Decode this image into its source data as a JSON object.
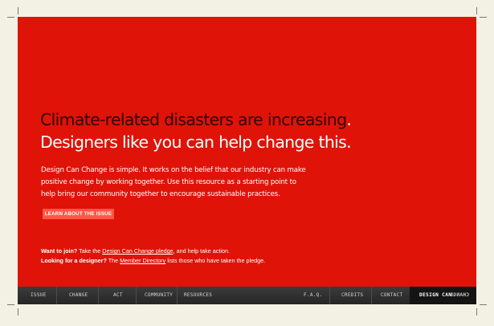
{
  "hero": {
    "headline_line1": "Climate-related disasters are increasing",
    "headline_line1_end": ".",
    "headline_line2": "Designers like you can help change this.",
    "intro": "Design Can Change is simple. It works on the belief that our industry can make positive change by working together. Use this resource as a starting point to help bring our community together to encourage sustainable practices.",
    "cta_label": "LEARN ABOUT THE ISSUE"
  },
  "join": {
    "q1_bold": "Want to join?",
    "q1_pre": " Take the ",
    "q1_link": "Design Can Change pledge",
    "q1_post": ", and help take action.",
    "q2_bold": "Looking for a designer?",
    "q2_pre": " The ",
    "q2_link": "Member Directory",
    "q2_post": " lists those who have taken the pledge."
  },
  "nav": {
    "issue": "ISSUE",
    "change": "CHANGE",
    "act": "ACT",
    "community": "COMMUNITY",
    "resources": "RESOURCES",
    "faq": "F.A.Q.",
    "credits": "CREDITS",
    "contact": "CONTACT",
    "logo_word1": "DESIGN CAN",
    "logo_word2": "CHANGE"
  },
  "colors": {
    "panel_red": "#e01309",
    "button": "#ff5747",
    "navbar": "#2f2f2f",
    "paper": "#f3f0e4"
  }
}
